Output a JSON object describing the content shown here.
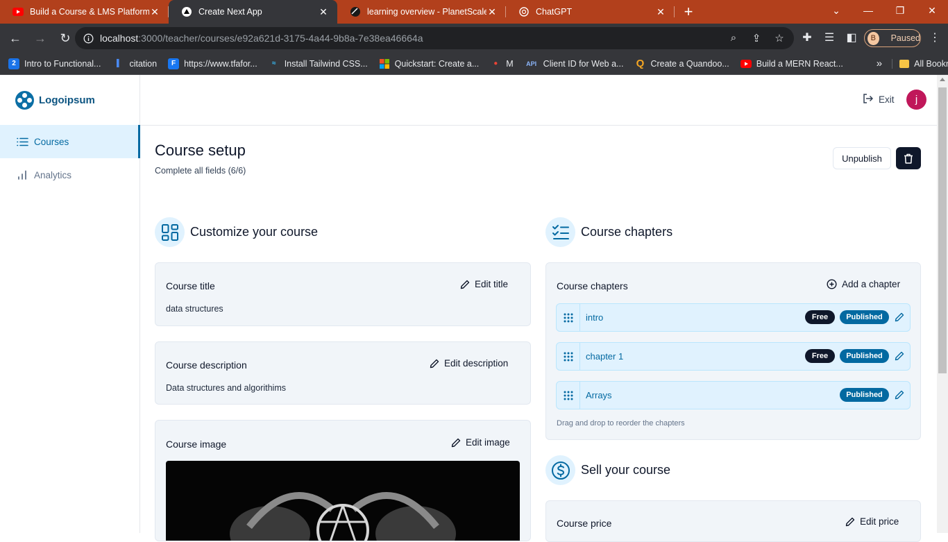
{
  "browser": {
    "tabs": [
      {
        "title": "Build a Course & LMS Platform: N",
        "icon": "youtube-icon"
      },
      {
        "title": "Create Next App",
        "icon": "nextjs-icon"
      },
      {
        "title": "learning overview - PlanetScale",
        "icon": "planetscale-icon"
      },
      {
        "title": "ChatGPT",
        "icon": "chatgpt-icon"
      }
    ],
    "url_host": "localhost",
    "url_path": ":3000/teacher/courses/e92a621d-3175-4a44-9b8a-7e38ea46664a",
    "profile_initial": "B",
    "profile_status": "Paused",
    "bookmarks": [
      {
        "label": "Intro to Functional...",
        "icon": "bookmark-icon"
      },
      {
        "label": "citation",
        "icon": "bookmark-icon"
      },
      {
        "label": "https://www.tfafor...",
        "icon": "f-icon"
      },
      {
        "label": "Install Tailwind CSS...",
        "icon": "tailwind-icon"
      },
      {
        "label": "Quickstart: Create a...",
        "icon": "microsoft-icon"
      },
      {
        "label": "M",
        "icon": "record-icon"
      },
      {
        "label": "Client ID for Web a...",
        "icon": "api-icon"
      },
      {
        "label": "Create a Quandoo...",
        "icon": "q-icon"
      },
      {
        "label": "Build a MERN React...",
        "icon": "youtube-icon"
      }
    ],
    "more_bookmarks": "»",
    "all_bookmarks": "All Bookmarks"
  },
  "app": {
    "logo_text": "Logoipsum",
    "sidebar": [
      {
        "label": "Courses",
        "active": true
      },
      {
        "label": "Analytics",
        "active": false
      }
    ],
    "exit_label": "Exit",
    "avatar_initial": "j",
    "page_title": "Course setup",
    "page_subtitle": "Complete all fields (6/6)",
    "unpublish_label": "Unpublish",
    "customize_heading": "Customize your course",
    "course_title": {
      "label": "Course title",
      "action": "Edit title",
      "value": "data structures"
    },
    "course_description": {
      "label": "Course description",
      "action": "Edit description",
      "value": "Data structures and algorithims"
    },
    "course_image": {
      "label": "Course image",
      "action": "Edit image"
    },
    "chapters_heading": "Course chapters",
    "chapters_card": {
      "label": "Course chapters",
      "action": "Add a chapter",
      "chapters": [
        {
          "title": "intro",
          "free": "Free",
          "status": "Published"
        },
        {
          "title": "chapter 1",
          "free": "Free",
          "status": "Published"
        },
        {
          "title": "Arrays",
          "free": null,
          "status": "Published"
        }
      ],
      "hint": "Drag and drop to reorder the chapters"
    },
    "sell_heading": "Sell your course",
    "course_price": {
      "label": "Course price",
      "action": "Edit price"
    },
    "colors": {
      "accent": "#0369a1",
      "accent_light": "#e0f2fe",
      "dark": "#0f172a",
      "avatar": "#c0175a",
      "tab_strip": "#b2401c"
    }
  }
}
